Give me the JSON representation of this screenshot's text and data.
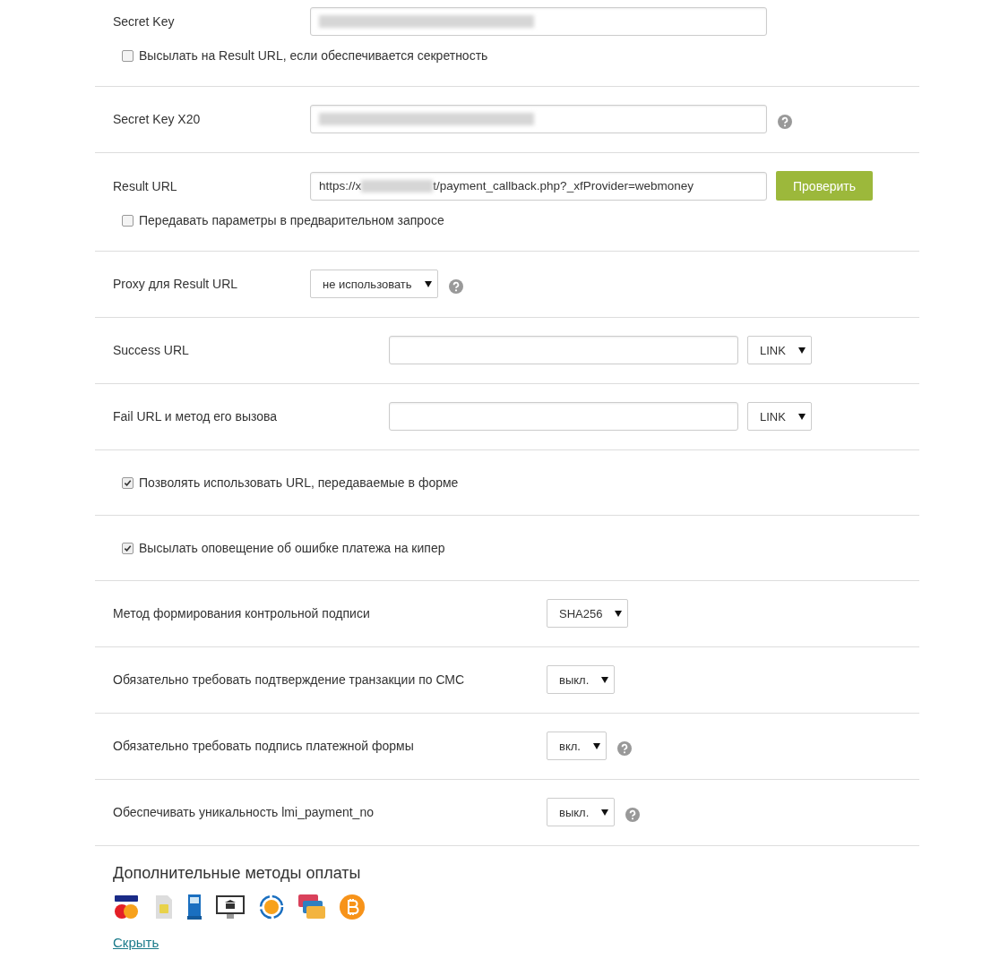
{
  "rows": [
    {
      "kind": "secret",
      "label": "Secret Key",
      "help": false,
      "checkbox": {
        "label": "Высылать на Result URL, если обеспечивается секретность",
        "checked": false
      }
    },
    {
      "kind": "secret",
      "label": "Secret Key X20",
      "help": true
    },
    {
      "kind": "url",
      "label": "Result URL",
      "value_start": "https://x",
      "value_end": "t/payment_callback.php?_xfProvider=webmoney",
      "button": "Проверить",
      "help": false,
      "checkbox": {
        "label": "Передавать параметры в предварительном запросе",
        "checked": false
      }
    },
    {
      "kind": "select",
      "label": "Proxy для Result URL",
      "value": "не использовать",
      "help": true
    },
    {
      "kind": "url-method",
      "label": "Success URL",
      "method": "LINK",
      "help": false
    },
    {
      "kind": "url-method",
      "label": "Fail URL и метод его вызова",
      "method": "LINK",
      "help": false
    },
    {
      "kind": "check",
      "checkbox": {
        "label": "Позволять использовать URL, передаваемые в форме",
        "checked": true
      }
    },
    {
      "kind": "check",
      "checkbox": {
        "label": "Высылать оповещение об ошибке платежа на кипер",
        "checked": true
      }
    },
    {
      "kind": "select-right",
      "label": "Метод формирования контрольной подписи",
      "value": "SHA256",
      "help": false
    },
    {
      "kind": "select-right",
      "label": "Обязательно требовать подтверждение транзакции по СМС",
      "value": "выкл.",
      "help": false
    },
    {
      "kind": "select-right",
      "label": "Обязательно требовать подпись платежной формы",
      "value": "вкл.",
      "help": true
    },
    {
      "kind": "select-right",
      "label": "Обеспечивать уникальность lmi_payment_no",
      "value": "выкл.",
      "help": true
    }
  ],
  "extra": {
    "title": "Дополнительные методы оплаты",
    "link": "Скрыть"
  }
}
